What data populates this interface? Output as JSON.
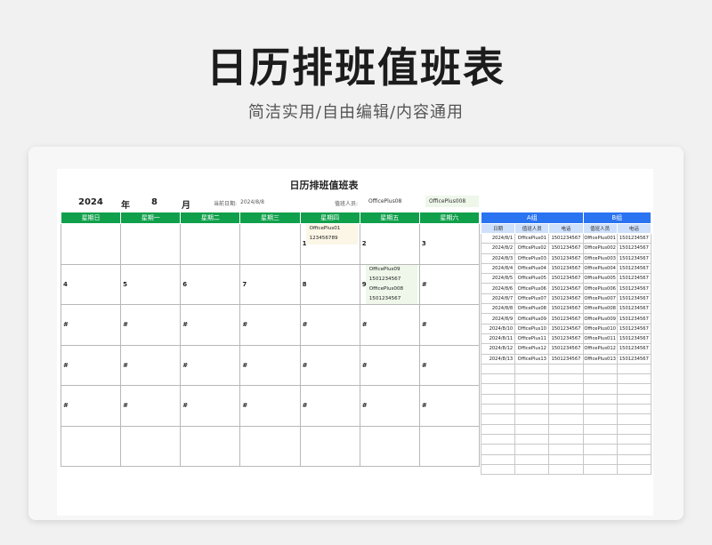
{
  "banner": {
    "title": "日历排班值班表",
    "subtitle": "简洁实用/自由编辑/内容通用"
  },
  "sheet": {
    "title": "日历排班值班表",
    "year": "2024",
    "year_unit": "年",
    "month": "8",
    "month_unit": "月",
    "date_label": "当前日期:",
    "date_value": "2024/8/8",
    "duty_label": "值班人员:",
    "duty_a": "OfficePlus08",
    "duty_b": "OfficePlus008"
  },
  "calendar": {
    "weekdays": [
      "星期日",
      "星期一",
      "星期二",
      "星期三",
      "星期四",
      "星期五",
      "星期六"
    ],
    "weeks": [
      [
        "",
        "",
        "",
        "",
        "1",
        "2",
        "3"
      ],
      [
        "4",
        "5",
        "6",
        "7",
        "8",
        "9",
        "#"
      ],
      [
        "#",
        "#",
        "#",
        "#",
        "#",
        "#",
        "#"
      ],
      [
        "#",
        "#",
        "#",
        "#",
        "#",
        "#",
        "#"
      ],
      [
        "#",
        "#",
        "#",
        "#",
        "#",
        "#",
        "#"
      ],
      [
        "",
        "",
        "",
        "",
        "",
        "",
        ""
      ]
    ],
    "day1_name": "OfficePlus01",
    "day1_phone": "123456789",
    "day9_name_a": "OfficePlus09",
    "day9_phone_a": "1501234567",
    "day9_name_b": "OfficePlus008",
    "day9_phone_b": "1501234567"
  },
  "schedule": {
    "group_a": "A组",
    "group_b": "B组",
    "col_date": "日期",
    "col_person": "值班人员",
    "col_phone": "电话",
    "rows": [
      [
        "2024/8/1",
        "OfficePlus01",
        "1501234567",
        "OfficePlus001",
        "1501234567"
      ],
      [
        "2024/8/2",
        "OfficePlus02",
        "1501234567",
        "OfficePlus002",
        "1501234567"
      ],
      [
        "2024/8/3",
        "OfficePlus03",
        "1501234567",
        "OfficePlus003",
        "1501234567"
      ],
      [
        "2024/8/4",
        "OfficePlus04",
        "1501234567",
        "OfficePlus004",
        "1501234567"
      ],
      [
        "2024/8/5",
        "OfficePlus05",
        "1501234567",
        "OfficePlus005",
        "1501234567"
      ],
      [
        "2024/8/6",
        "OfficePlus06",
        "1501234567",
        "OfficePlus006",
        "1501234567"
      ],
      [
        "2024/8/7",
        "OfficePlus07",
        "1501234567",
        "OfficePlus007",
        "1501234567"
      ],
      [
        "2024/8/8",
        "OfficePlus08",
        "1501234567",
        "OfficePlus008",
        "1501234567"
      ],
      [
        "2024/8/9",
        "OfficePlus09",
        "1501234567",
        "OfficePlus009",
        "1501234567"
      ],
      [
        "2024/8/10",
        "OfficePlus10",
        "1501234567",
        "OfficePlus010",
        "1501234567"
      ],
      [
        "2024/8/11",
        "OfficePlus11",
        "1501234567",
        "OfficePlus011",
        "1501234567"
      ],
      [
        "2024/8/12",
        "OfficePlus12",
        "1501234567",
        "OfficePlus012",
        "1501234567"
      ],
      [
        "2024/8/13",
        "OfficePlus13",
        "1501234567",
        "OfficePlus013",
        "1501234567"
      ],
      [
        "",
        "",
        "",
        "",
        ""
      ],
      [
        "",
        "",
        "",
        "",
        ""
      ],
      [
        "",
        "",
        "",
        "",
        ""
      ],
      [
        "",
        "",
        "",
        "",
        ""
      ],
      [
        "",
        "",
        "",
        "",
        ""
      ],
      [
        "",
        "",
        "",
        "",
        ""
      ],
      [
        "",
        "",
        "",
        "",
        ""
      ],
      [
        "",
        "",
        "",
        "",
        ""
      ],
      [
        "",
        "",
        "",
        "",
        ""
      ],
      [
        "",
        "",
        "",
        "",
        ""
      ],
      [
        "",
        "",
        "",
        "",
        ""
      ]
    ]
  }
}
